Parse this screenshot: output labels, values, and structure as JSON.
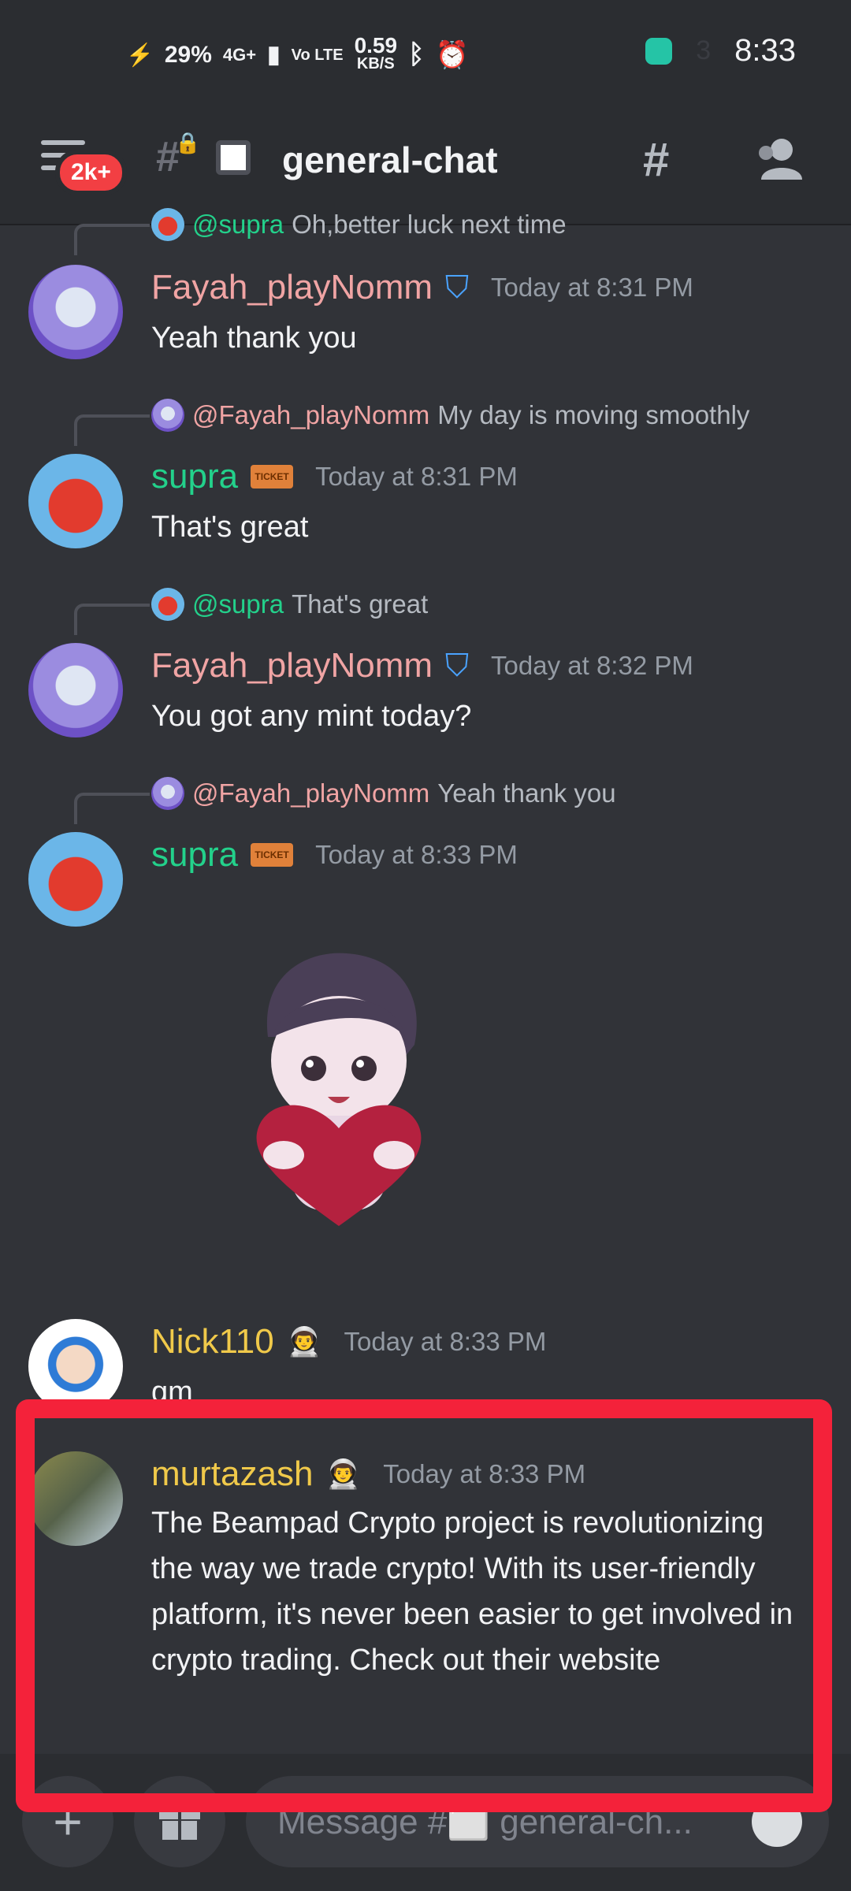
{
  "status_bar": {
    "battery": "29%",
    "network": "4G+",
    "volte": "Vo LTE",
    "speed": "0.59",
    "speed_unit": "KB/S",
    "time": "8:33"
  },
  "header": {
    "badge": "2k+",
    "channel_name": "general-chat"
  },
  "messages": [
    {
      "reply_to": "@supra",
      "reply_text": "Oh,better luck next time",
      "author": "Fayah_playNomm",
      "timestamp": "Today at 8:31 PM",
      "text": "Yeah thank you"
    },
    {
      "reply_to": "@Fayah_playNomm",
      "reply_text": "My day is moving smoothly",
      "author": "supra",
      "timestamp": "Today at 8:31 PM",
      "text": "That's great"
    },
    {
      "reply_to": "@supra",
      "reply_text": "That's great",
      "author": "Fayah_playNomm",
      "timestamp": "Today at 8:32 PM",
      "text": "You got any mint today?"
    },
    {
      "reply_to": "@Fayah_playNomm",
      "reply_text": "Yeah thank you",
      "author": "supra",
      "timestamp": "Today at 8:33 PM",
      "text": ""
    },
    {
      "author": "Nick110",
      "timestamp": "Today at 8:33 PM",
      "text": "gm"
    },
    {
      "author": "murtazash",
      "timestamp": "Today at 8:33 PM",
      "text": "The Beampad Crypto project is revolutionizing the way we trade crypto! With its user-friendly platform, it's never been easier to get involved in crypto trading. Check out their website"
    }
  ],
  "composer": {
    "placeholder": "Message #⬜ general-ch..."
  },
  "colors": {
    "background": "#313338",
    "header": "#2b2d31",
    "highlight_border": "#f4223a",
    "username_pink": "#f0a4a4",
    "username_green": "#23d18b",
    "username_yellow": "#f0c94a"
  }
}
